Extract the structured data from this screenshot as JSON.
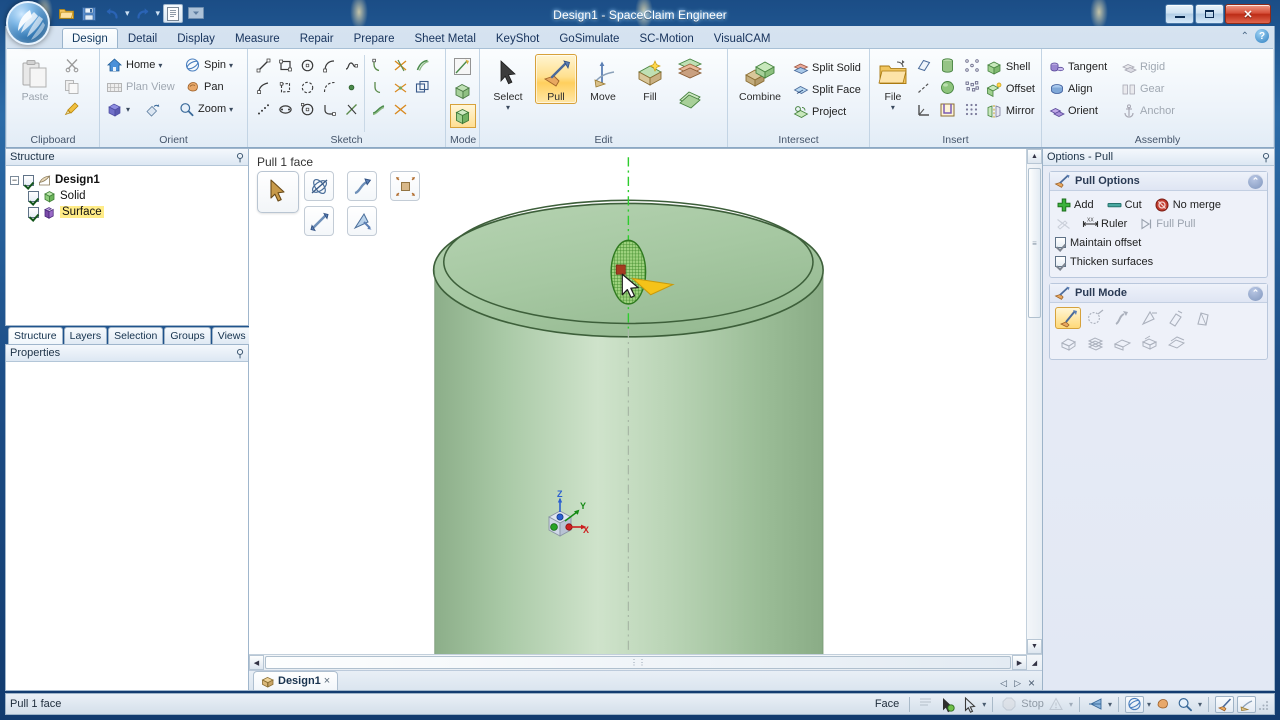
{
  "window": {
    "title": "Design1 - SpaceClaim Engineer",
    "minimize_label": "Minimize",
    "maximize_label": "Maximize",
    "close_label": "Close"
  },
  "quick_access": [
    {
      "name": "open-icon",
      "label": "Open"
    },
    {
      "name": "save-icon",
      "label": "Save"
    },
    {
      "name": "undo-icon",
      "label": "Undo"
    },
    {
      "name": "redo-icon",
      "label": "Redo"
    },
    {
      "name": "properties-icon",
      "label": "Properties"
    },
    {
      "name": "customize-icon",
      "label": "Customize Quick Access Toolbar"
    }
  ],
  "ribbon": {
    "tabs": [
      {
        "label": "Design",
        "active": true
      },
      {
        "label": "Detail",
        "active": false
      },
      {
        "label": "Display",
        "active": false
      },
      {
        "label": "Measure",
        "active": false
      },
      {
        "label": "Repair",
        "active": false
      },
      {
        "label": "Prepare",
        "active": false
      },
      {
        "label": "Sheet Metal",
        "active": false
      },
      {
        "label": "KeyShot",
        "active": false
      },
      {
        "label": "GoSimulate",
        "active": false
      },
      {
        "label": "SC-Motion",
        "active": false
      },
      {
        "label": "VisualCAM",
        "active": false
      }
    ],
    "groups": {
      "clipboard": {
        "label": "Clipboard",
        "paste": "Paste",
        "cut": "Cut",
        "copy": "Copy",
        "format_painter": "Format Painter"
      },
      "orient": {
        "label": "Orient",
        "home": "Home",
        "plan_view": "Plan View",
        "spin": "Spin",
        "pan": "Pan",
        "zoom": "Zoom",
        "view_cube": "View",
        "look_at": "Look At"
      },
      "sketch": {
        "label": "Sketch"
      },
      "mode": {
        "label": "Mode",
        "sketch_mode": "Sketch Mode",
        "section_mode": "Section Mode",
        "three_d_mode": "3D Mode"
      },
      "edit": {
        "label": "Edit",
        "select": "Select",
        "pull": "Pull",
        "move": "Move",
        "fill": "Fill",
        "blend": "Blend"
      },
      "intersect": {
        "label": "Intersect",
        "combine": "Combine",
        "split_solid": "Split Solid",
        "split_face": "Split Face",
        "project": "Project"
      },
      "insert": {
        "label": "Insert",
        "file": "File",
        "plane": "Plane",
        "axis": "Axis",
        "origin": "Origin",
        "cylinder": "Cylinder",
        "sphere": "Sphere",
        "volume": "Volume",
        "shell": "Shell",
        "offset": "Offset",
        "mirror": "Mirror",
        "pattern_circular": "Circular Pattern",
        "pattern_fill": "Fill Pattern",
        "pattern_linear": "Linear Pattern"
      },
      "assembly": {
        "label": "Assembly",
        "tangent": "Tangent",
        "align": "Align",
        "orient": "Orient",
        "rigid": "Rigid",
        "gear": "Gear",
        "anchor": "Anchor"
      }
    },
    "help_label": "Help",
    "minimize_ribbon_label": "Minimize the Ribbon"
  },
  "structure_panel": {
    "title": "Structure",
    "pin_label": "Auto Hide",
    "tree": [
      {
        "label": "Design1",
        "checked": true,
        "bold": true,
        "selected": false,
        "icon": "design-icon",
        "expanded": true
      },
      {
        "label": "Solid",
        "checked": true,
        "bold": false,
        "selected": false,
        "icon": "solid-icon"
      },
      {
        "label": "Surface",
        "checked": true,
        "bold": false,
        "selected": true,
        "icon": "surface-icon"
      }
    ],
    "tabs": [
      {
        "label": "Structure",
        "active": true
      },
      {
        "label": "Layers",
        "active": false
      },
      {
        "label": "Selection",
        "active": false
      },
      {
        "label": "Groups",
        "active": false
      },
      {
        "label": "Views",
        "active": false
      }
    ]
  },
  "properties_panel": {
    "title": "Properties",
    "pin_label": "Auto Hide"
  },
  "viewport": {
    "title": "Pull 1 face",
    "mini_toolbar": [
      {
        "name": "select-cursor-tool",
        "label": "Select"
      },
      {
        "name": "revolve-tool",
        "label": "Revolve"
      },
      {
        "name": "sweep-tool",
        "label": "Sweep"
      },
      {
        "name": "scale-body-tool",
        "label": "Scale Body"
      },
      {
        "name": "directional-pull-tool",
        "label": "Pull in Direction"
      },
      {
        "name": "draft-tool",
        "label": "Draft"
      }
    ],
    "axis_triad": {
      "x": "X",
      "y": "Y",
      "z": "Z"
    }
  },
  "document_tabs": [
    {
      "label": "Design1",
      "close": "×",
      "active": true
    }
  ],
  "doc_tab_nav": {
    "prev": "◁",
    "next": "▷",
    "close": "×"
  },
  "options_panel": {
    "title": "Options - Pull",
    "pin_label": "Auto Hide",
    "sections": [
      {
        "title": "Pull Options",
        "collapse_label": "Collapse",
        "rows": [
          [
            {
              "name": "add-option",
              "label": "Add",
              "icon": "plus-icon",
              "disabled": false
            },
            {
              "name": "cut-option",
              "label": "Cut",
              "icon": "cut-bar-icon",
              "disabled": false
            },
            {
              "name": "no-merge-option",
              "label": "No merge",
              "icon": "no-merge-icon",
              "disabled": false
            }
          ],
          [
            {
              "name": "no-ruler-option",
              "label": "",
              "icon": "ruler-off-icon",
              "disabled": true
            },
            {
              "name": "ruler-option",
              "label": "Ruler",
              "icon": "ruler-icon",
              "disabled": false
            },
            {
              "name": "full-pull-option",
              "label": "Full Pull",
              "icon": "full-pull-icon",
              "disabled": true
            }
          ]
        ],
        "checkboxes": [
          {
            "name": "maintain-offset-checkbox",
            "label": "Maintain offset",
            "checked": true,
            "disabled": true
          },
          {
            "name": "thicken-surfaces-checkbox",
            "label": "Thicken surfaces",
            "checked": true,
            "disabled": true
          }
        ]
      },
      {
        "title": "Pull Mode",
        "collapse_label": "Collapse",
        "modes_row1": [
          {
            "name": "pull-mode-offset",
            "label": "Offset",
            "active": true
          },
          {
            "name": "pull-mode-round",
            "label": "Round",
            "active": false
          },
          {
            "name": "pull-mode-extrude-edge",
            "label": "Extrude Edge",
            "active": false
          },
          {
            "name": "pull-mode-revolve",
            "label": "Revolve",
            "active": false
          },
          {
            "name": "pull-mode-sweep",
            "label": "Sweep",
            "active": false
          },
          {
            "name": "pull-mode-draft",
            "label": "Draft",
            "active": false
          }
        ],
        "modes_row2": [
          {
            "name": "pull-mode-tangent",
            "label": "Tangent",
            "active": false
          },
          {
            "name": "pull-mode-blend",
            "label": "Blend",
            "active": false
          },
          {
            "name": "pull-mode-chamfer",
            "label": "Chamfer",
            "active": false
          },
          {
            "name": "pull-mode-pivot",
            "label": "Pivot",
            "active": false
          },
          {
            "name": "pull-mode-scale",
            "label": "Scale",
            "active": false
          }
        ]
      }
    ]
  },
  "status_bar": {
    "message": "Pull 1 face",
    "entity_type": "Face",
    "stop_label": "Stop",
    "buttons": [
      {
        "name": "select-filter-icon",
        "label": "Selection Filter"
      },
      {
        "name": "select-cursor-icon",
        "label": "Select"
      },
      {
        "name": "warning-icon",
        "label": "Warnings"
      },
      {
        "name": "clip-icon",
        "label": "Clipping"
      },
      {
        "name": "spin-icon",
        "label": "Spin"
      },
      {
        "name": "pan-icon",
        "label": "Pan"
      },
      {
        "name": "zoom-icon",
        "label": "Zoom"
      },
      {
        "name": "pull-icon",
        "label": "Pull"
      },
      {
        "name": "move-icon",
        "label": "Move"
      }
    ]
  },
  "colors": {
    "accent": "#ffcf5e",
    "model_green": "#a9c9a6",
    "selection_yellow": "#ffec87",
    "title_blue": "#1d4e87"
  }
}
